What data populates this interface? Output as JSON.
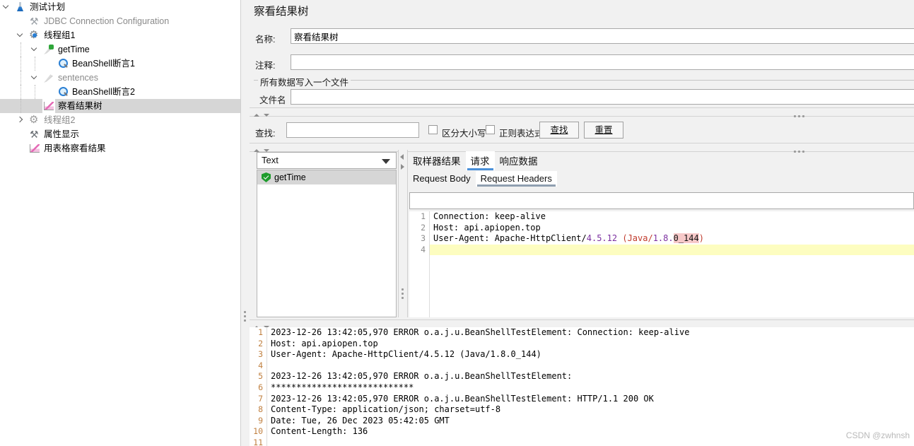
{
  "tree": {
    "items": [
      {
        "label": "测试计划",
        "icon": "test-plan-icon",
        "indent": 0,
        "chev": "down",
        "dim": false,
        "selected": false,
        "name": "tree-item-test-plan"
      },
      {
        "label": "JDBC Connection Configuration",
        "icon": "config-tool-icon",
        "indent": 1,
        "chev": "none",
        "dim": true,
        "selected": false,
        "name": "tree-item-jdbc-connection-configuration"
      },
      {
        "label": "线程组1",
        "icon": "thread-group-icon",
        "indent": 1,
        "chev": "down",
        "dim": false,
        "selected": false,
        "name": "tree-item-thread-group-1"
      },
      {
        "label": "getTime",
        "icon": "sampler-icon",
        "indent": 2,
        "chev": "down",
        "dim": false,
        "selected": false,
        "name": "tree-item-gettime"
      },
      {
        "label": "BeanShell断言1",
        "icon": "assertion-icon",
        "indent": 3,
        "chev": "none",
        "dim": false,
        "selected": false,
        "name": "tree-item-beanshell-assertion-1"
      },
      {
        "label": "sentences",
        "icon": "sampler-disabled-icon",
        "indent": 2,
        "chev": "down",
        "dim": true,
        "selected": false,
        "name": "tree-item-sentences"
      },
      {
        "label": "BeanShell断言2",
        "icon": "assertion-icon",
        "indent": 3,
        "chev": "none",
        "dim": false,
        "selected": false,
        "name": "tree-item-beanshell-assertion-2"
      },
      {
        "label": "察看结果树",
        "icon": "view-results-tree-icon",
        "indent": 2,
        "chev": "none",
        "dim": false,
        "selected": true,
        "name": "tree-item-view-results-tree"
      },
      {
        "label": "线程组2",
        "icon": "thread-group-disabled-icon",
        "indent": 1,
        "chev": "right",
        "dim": true,
        "selected": false,
        "name": "tree-item-thread-group-2"
      },
      {
        "label": "属性显示",
        "icon": "property-display-icon",
        "indent": 1,
        "chev": "none",
        "dim": false,
        "selected": false,
        "name": "tree-item-property-display"
      },
      {
        "label": "用表格察看结果",
        "icon": "view-results-table-icon",
        "indent": 1,
        "chev": "none",
        "dim": false,
        "selected": false,
        "name": "tree-item-view-results-in-table"
      }
    ]
  },
  "panel": {
    "title": "察看结果树",
    "name_label": "名称:",
    "name_value": "察看结果树",
    "comment_label": "注释:",
    "comment_value": "",
    "group_title": "所有数据写入一个文件",
    "filename_label": "文件名",
    "filename_value": ""
  },
  "search": {
    "label": "查找:",
    "value": "",
    "case_sensitive_label": "区分大小写",
    "case_sensitive_checked": false,
    "regex_label": "正则表达式",
    "regex_checked": false,
    "find_button": "查找",
    "reset_button": "重置"
  },
  "results": {
    "renderer_selected": "Text",
    "sampler_items": [
      {
        "label": "getTime",
        "status": "success"
      }
    ],
    "tabs": [
      {
        "label": "取样器结果",
        "selected": false,
        "name": "tab-sampler-result"
      },
      {
        "label": "请求",
        "selected": true,
        "name": "tab-request"
      },
      {
        "label": "响应数据",
        "selected": false,
        "name": "tab-response-data"
      }
    ],
    "subtabs": [
      {
        "label": "Request Body",
        "selected": false,
        "name": "subtab-request-body"
      },
      {
        "label": "Request Headers",
        "selected": true,
        "name": "subtab-request-headers"
      }
    ],
    "find_field_value": "",
    "headers": [
      {
        "n": "1",
        "text": "Connection: keep-alive",
        "hl": false
      },
      {
        "n": "2",
        "text": "Host: api.apiopen.top",
        "hl": false
      },
      {
        "n": "3",
        "text": "User-Agent: Apache-HttpClient/4.5.12 (Java/1.8.0_144)",
        "hl": false
      },
      {
        "n": "4",
        "text": "",
        "hl": true
      }
    ]
  },
  "log": {
    "lines": [
      {
        "n": "1",
        "text": "2023-12-26 13:42:05,970 ERROR o.a.j.u.BeanShellTestElement: Connection: keep-alive"
      },
      {
        "n": "2",
        "text": "Host: api.apiopen.top"
      },
      {
        "n": "3",
        "text": "User-Agent: Apache-HttpClient/4.5.12 (Java/1.8.0_144)"
      },
      {
        "n": "4",
        "text": ""
      },
      {
        "n": "5",
        "text": "2023-12-26 13:42:05,970 ERROR o.a.j.u.BeanShellTestElement:"
      },
      {
        "n": "6",
        "text": "****************************"
      },
      {
        "n": "7",
        "text": "2023-12-26 13:42:05,970 ERROR o.a.j.u.BeanShellTestElement: HTTP/1.1 200 OK"
      },
      {
        "n": "8",
        "text": "Content-Type: application/json; charset=utf-8"
      },
      {
        "n": "9",
        "text": "Date: Tue, 26 Dec 2023 05:42:05 GMT"
      },
      {
        "n": "10",
        "text": "Content-Length: 136"
      },
      {
        "n": "11",
        "text": ""
      }
    ]
  },
  "watermark": "CSDN @zwhnsh",
  "colors": {
    "selection": "#d6d6d6",
    "accent": "#4a90d9",
    "panel_bg": "#f1f1f1",
    "highlight": "#fdfdc0"
  }
}
